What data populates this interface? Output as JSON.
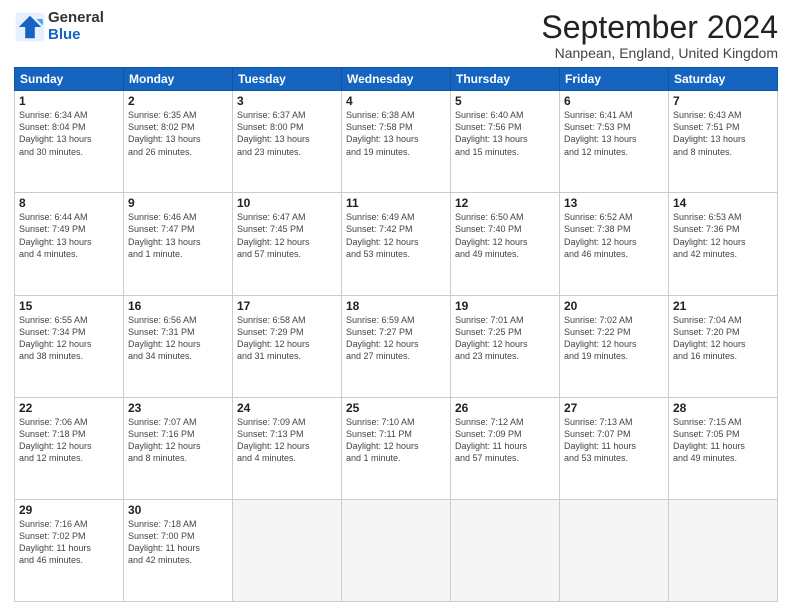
{
  "logo": {
    "general": "General",
    "blue": "Blue"
  },
  "title": "September 2024",
  "location": "Nanpean, England, United Kingdom",
  "days_of_week": [
    "Sunday",
    "Monday",
    "Tuesday",
    "Wednesday",
    "Thursday",
    "Friday",
    "Saturday"
  ],
  "weeks": [
    [
      {
        "day": 1,
        "info": "Sunrise: 6:34 AM\nSunset: 8:04 PM\nDaylight: 13 hours\nand 30 minutes."
      },
      {
        "day": 2,
        "info": "Sunrise: 6:35 AM\nSunset: 8:02 PM\nDaylight: 13 hours\nand 26 minutes."
      },
      {
        "day": 3,
        "info": "Sunrise: 6:37 AM\nSunset: 8:00 PM\nDaylight: 13 hours\nand 23 minutes."
      },
      {
        "day": 4,
        "info": "Sunrise: 6:38 AM\nSunset: 7:58 PM\nDaylight: 13 hours\nand 19 minutes."
      },
      {
        "day": 5,
        "info": "Sunrise: 6:40 AM\nSunset: 7:56 PM\nDaylight: 13 hours\nand 15 minutes."
      },
      {
        "day": 6,
        "info": "Sunrise: 6:41 AM\nSunset: 7:53 PM\nDaylight: 13 hours\nand 12 minutes."
      },
      {
        "day": 7,
        "info": "Sunrise: 6:43 AM\nSunset: 7:51 PM\nDaylight: 13 hours\nand 8 minutes."
      }
    ],
    [
      {
        "day": 8,
        "info": "Sunrise: 6:44 AM\nSunset: 7:49 PM\nDaylight: 13 hours\nand 4 minutes."
      },
      {
        "day": 9,
        "info": "Sunrise: 6:46 AM\nSunset: 7:47 PM\nDaylight: 13 hours\nand 1 minute."
      },
      {
        "day": 10,
        "info": "Sunrise: 6:47 AM\nSunset: 7:45 PM\nDaylight: 12 hours\nand 57 minutes."
      },
      {
        "day": 11,
        "info": "Sunrise: 6:49 AM\nSunset: 7:42 PM\nDaylight: 12 hours\nand 53 minutes."
      },
      {
        "day": 12,
        "info": "Sunrise: 6:50 AM\nSunset: 7:40 PM\nDaylight: 12 hours\nand 49 minutes."
      },
      {
        "day": 13,
        "info": "Sunrise: 6:52 AM\nSunset: 7:38 PM\nDaylight: 12 hours\nand 46 minutes."
      },
      {
        "day": 14,
        "info": "Sunrise: 6:53 AM\nSunset: 7:36 PM\nDaylight: 12 hours\nand 42 minutes."
      }
    ],
    [
      {
        "day": 15,
        "info": "Sunrise: 6:55 AM\nSunset: 7:34 PM\nDaylight: 12 hours\nand 38 minutes."
      },
      {
        "day": 16,
        "info": "Sunrise: 6:56 AM\nSunset: 7:31 PM\nDaylight: 12 hours\nand 34 minutes."
      },
      {
        "day": 17,
        "info": "Sunrise: 6:58 AM\nSunset: 7:29 PM\nDaylight: 12 hours\nand 31 minutes."
      },
      {
        "day": 18,
        "info": "Sunrise: 6:59 AM\nSunset: 7:27 PM\nDaylight: 12 hours\nand 27 minutes."
      },
      {
        "day": 19,
        "info": "Sunrise: 7:01 AM\nSunset: 7:25 PM\nDaylight: 12 hours\nand 23 minutes."
      },
      {
        "day": 20,
        "info": "Sunrise: 7:02 AM\nSunset: 7:22 PM\nDaylight: 12 hours\nand 19 minutes."
      },
      {
        "day": 21,
        "info": "Sunrise: 7:04 AM\nSunset: 7:20 PM\nDaylight: 12 hours\nand 16 minutes."
      }
    ],
    [
      {
        "day": 22,
        "info": "Sunrise: 7:06 AM\nSunset: 7:18 PM\nDaylight: 12 hours\nand 12 minutes."
      },
      {
        "day": 23,
        "info": "Sunrise: 7:07 AM\nSunset: 7:16 PM\nDaylight: 12 hours\nand 8 minutes."
      },
      {
        "day": 24,
        "info": "Sunrise: 7:09 AM\nSunset: 7:13 PM\nDaylight: 12 hours\nand 4 minutes."
      },
      {
        "day": 25,
        "info": "Sunrise: 7:10 AM\nSunset: 7:11 PM\nDaylight: 12 hours\nand 1 minute."
      },
      {
        "day": 26,
        "info": "Sunrise: 7:12 AM\nSunset: 7:09 PM\nDaylight: 11 hours\nand 57 minutes."
      },
      {
        "day": 27,
        "info": "Sunrise: 7:13 AM\nSunset: 7:07 PM\nDaylight: 11 hours\nand 53 minutes."
      },
      {
        "day": 28,
        "info": "Sunrise: 7:15 AM\nSunset: 7:05 PM\nDaylight: 11 hours\nand 49 minutes."
      }
    ],
    [
      {
        "day": 29,
        "info": "Sunrise: 7:16 AM\nSunset: 7:02 PM\nDaylight: 11 hours\nand 46 minutes."
      },
      {
        "day": 30,
        "info": "Sunrise: 7:18 AM\nSunset: 7:00 PM\nDaylight: 11 hours\nand 42 minutes."
      },
      null,
      null,
      null,
      null,
      null
    ]
  ]
}
